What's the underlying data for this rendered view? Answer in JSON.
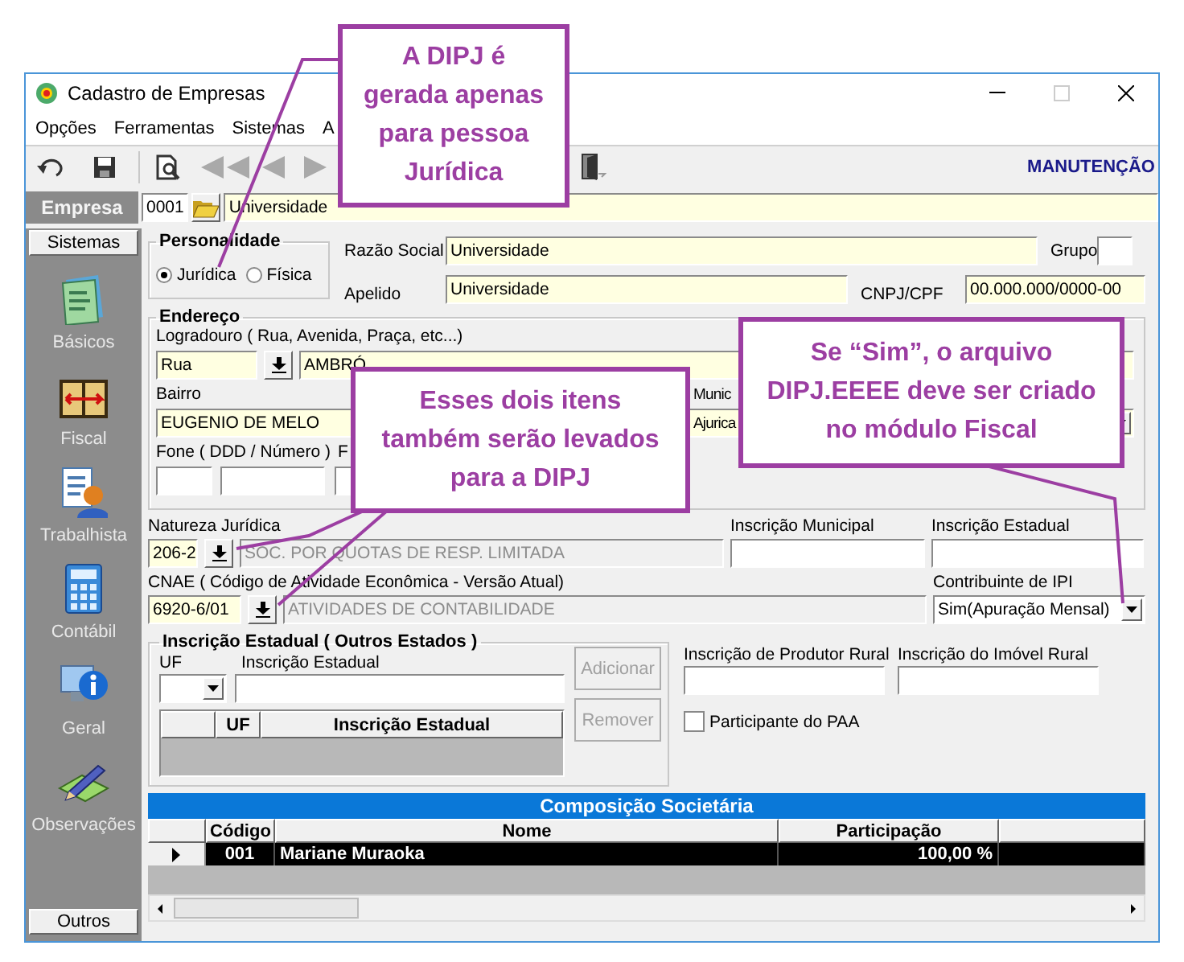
{
  "window": {
    "title": "Cadastro de Empresas"
  },
  "menu": [
    {
      "label": "Opções"
    },
    {
      "label": "Ferramentas"
    },
    {
      "label": "Sistemas"
    },
    {
      "label": "A"
    }
  ],
  "toolbar": {
    "buttons": [
      {
        "kind": "undo",
        "disabled": false
      },
      {
        "kind": "save",
        "disabled": false
      },
      {
        "kind": "preview",
        "disabled": false
      },
      {
        "kind": "first",
        "disabled": true
      },
      {
        "kind": "previous",
        "disabled": true
      },
      {
        "kind": "next",
        "disabled": true
      },
      {
        "kind": "exit",
        "disabled": false
      }
    ],
    "mode": "MANUTENÇÃO"
  },
  "empresa": {
    "label": "Empresa",
    "code": "0001",
    "name": "Universidade"
  },
  "sidebar": {
    "header": "Sistemas",
    "items": [
      {
        "label": "Básicos",
        "kind": "basicos"
      },
      {
        "label": "Fiscal",
        "kind": "fiscal"
      },
      {
        "label": "Trabalhista",
        "kind": "trabalhista"
      },
      {
        "label": "Contábil",
        "kind": "contabil"
      },
      {
        "label": "Geral",
        "kind": "geral"
      },
      {
        "label": "Observações",
        "kind": "observacoes"
      }
    ],
    "footer": "Outros"
  },
  "personalidade": {
    "title": "Personalidade",
    "options": [
      {
        "label": "Jurídica",
        "selected": true
      },
      {
        "label": "Física",
        "selected": false
      }
    ]
  },
  "razao_social": {
    "label": "Razão Social",
    "value": "Universidade"
  },
  "grupo": {
    "label": "Grupo"
  },
  "apelido": {
    "label": "Apelido",
    "value": "Universidade"
  },
  "cnpj_cpf": {
    "label": "CNPJ/CPF",
    "value": "00.000.000/0000-00"
  },
  "endereco": {
    "title": "Endereço",
    "logradouro_label": "Logradouro ( Rua, Avenida, Praça, etc...)",
    "tipo": "Rua",
    "logradouro": "AMBRÓ",
    "bairro_label": "Bairro",
    "bairro": "EUGENIO DE MELO",
    "municipio_label": "Munic",
    "municipio": "Ajurica",
    "fone_label": "Fone ( DDD / Número )",
    "column_label": "F"
  },
  "natureza_juridica": {
    "label": "Natureza Jurídica",
    "code": "206-2",
    "description": "SOC. POR QUOTAS DE RESP. LIMITADA"
  },
  "inscricao_municipal": {
    "label": "Inscrição Municipal"
  },
  "inscricao_estadual": {
    "label": "Inscrição Estadual"
  },
  "cnae": {
    "label": "CNAE ( Código de Atividade Econômica - Versão Atual)",
    "code": "6920-6/01",
    "description": "ATIVIDADES DE CONTABILIDADE"
  },
  "contribuinte_ipi": {
    "label": "Contribuinte de IPI",
    "value": "Sim(Apuração Mensal)"
  },
  "outros_estados": {
    "title": "Inscrição Estadual ( Outros Estados )",
    "uf_label": "UF",
    "ie_label": "Inscrição Estadual",
    "columns": [
      "UF",
      "Inscrição Estadual"
    ],
    "buttons": [
      {
        "label": "Adicionar",
        "disabled": true
      },
      {
        "label": "Remover",
        "disabled": true
      }
    ]
  },
  "produtor_rural": {
    "label": "Inscrição de Produtor Rural"
  },
  "imovel_rural": {
    "label": "Inscrição do Imóvel Rural"
  },
  "paa": {
    "label": "Participante do PAA",
    "checked": false
  },
  "composicao": {
    "title": "Composição Societária",
    "columns": [
      "Código",
      "Nome",
      "Participação"
    ],
    "rows": [
      {
        "codigo": "001",
        "nome": "Mariane Muraoka",
        "participacao": "100,00 %",
        "selected": true
      }
    ]
  },
  "callouts": [
    {
      "text": "A DIPJ é gerada apenas para pessoa Jurídica"
    },
    {
      "text": "Esses dois itens também serão levados para a DIPJ"
    },
    {
      "text": "Se “Sim”, o arquivo DIPJ.EEEE deve ser criado no módulo Fiscal"
    }
  ]
}
